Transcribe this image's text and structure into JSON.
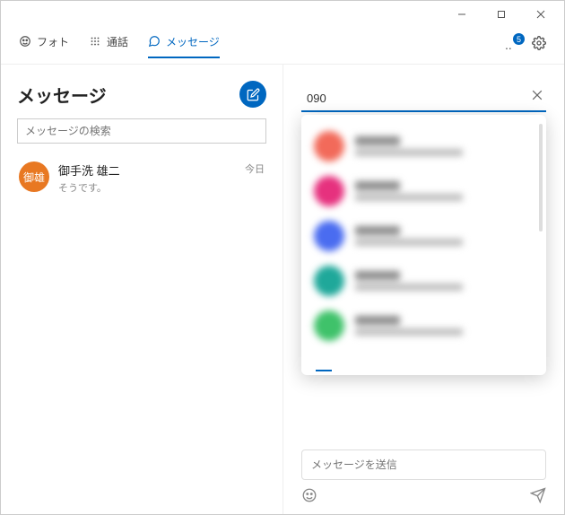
{
  "tabs": {
    "photo": "フォト",
    "call": "通話",
    "message": "メッセージ"
  },
  "badge_count": "5",
  "left": {
    "title": "メッセージ",
    "search_placeholder": "メッセージの検索"
  },
  "conversation": {
    "avatar_text": "御雄",
    "name": "御手洗 雄二",
    "preview": "そうです。",
    "time": "今日",
    "avatar_color": "#e87822"
  },
  "right": {
    "search_value": "090",
    "message_placeholder": "メッセージを送信"
  },
  "dropdown_colors": [
    "#f26a5a",
    "#e6317e",
    "#4a6cf0",
    "#1fa89a",
    "#3fc26a"
  ]
}
